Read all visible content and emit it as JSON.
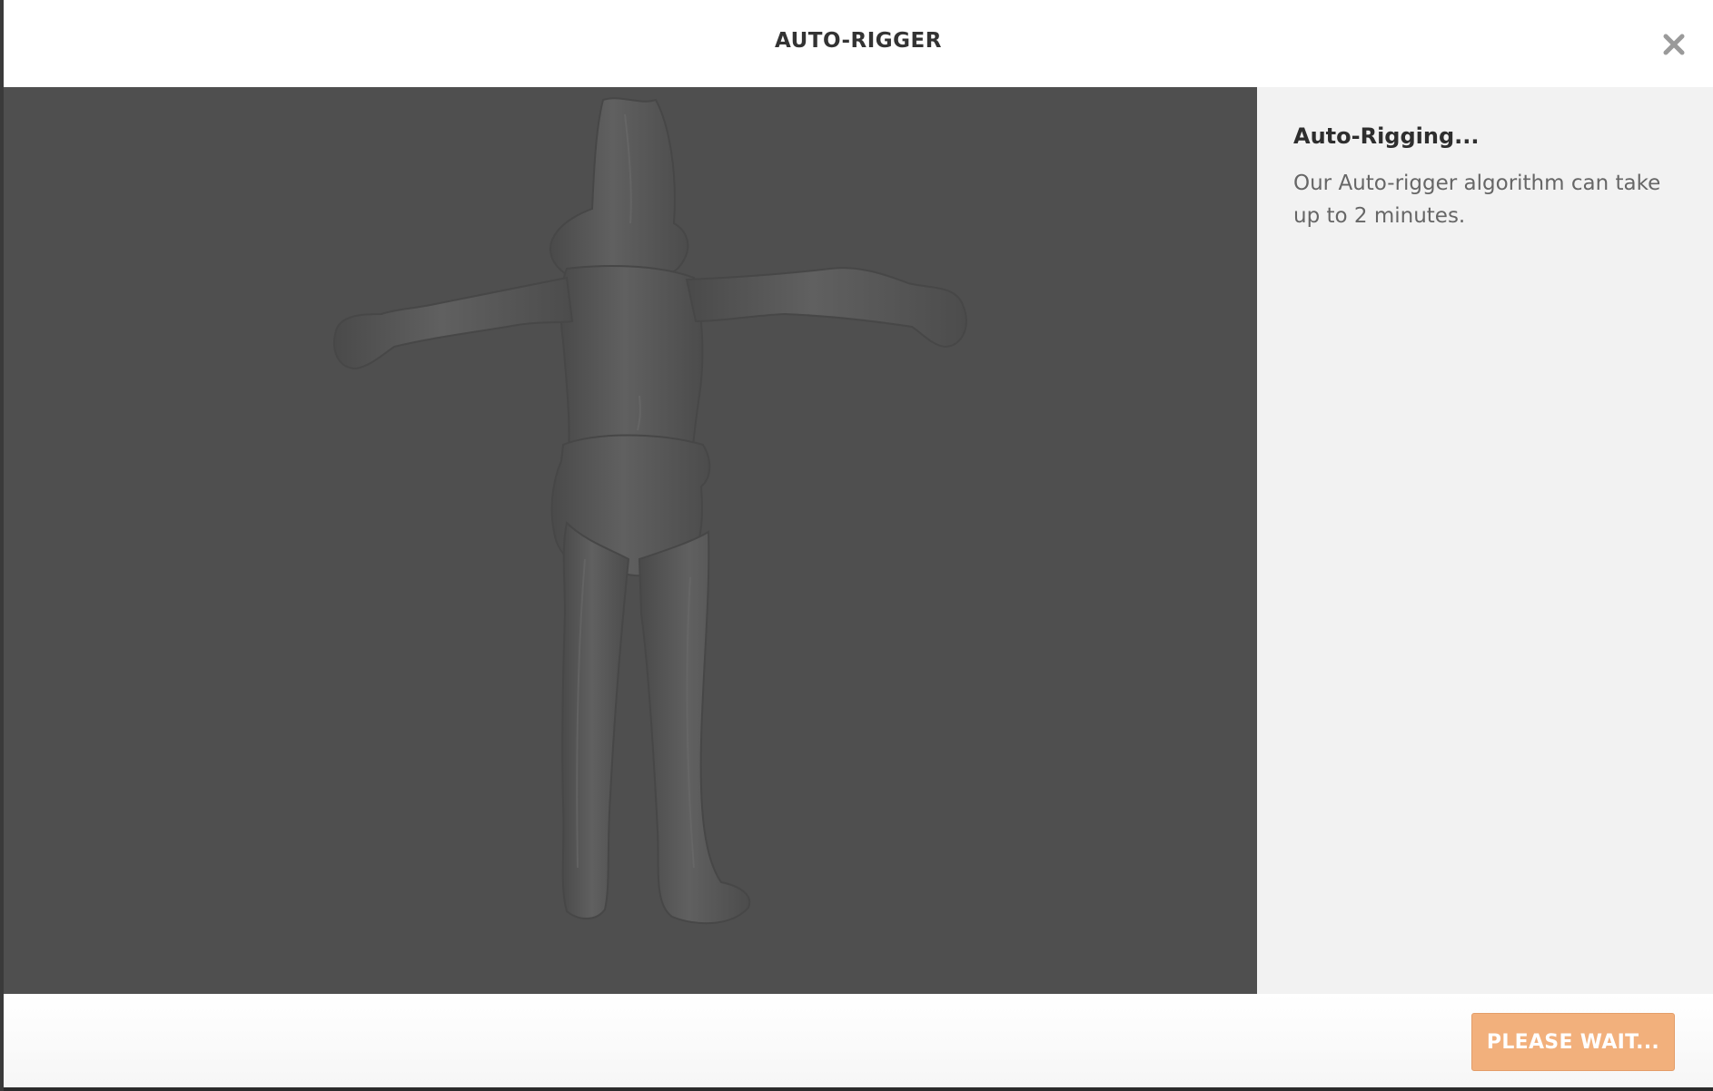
{
  "dialog": {
    "title": "AUTO-RIGGER",
    "close_icon": "close-icon"
  },
  "viewport": {
    "background_color": "#4f4f4f",
    "model_color": "#5a5a5a"
  },
  "side_panel": {
    "heading": "Auto-Rigging...",
    "description": "Our Auto-rigger algorithm can take up to 2 minutes."
  },
  "footer": {
    "button_label": "PLEASE WAIT...",
    "button_color": "#f2b07c"
  }
}
